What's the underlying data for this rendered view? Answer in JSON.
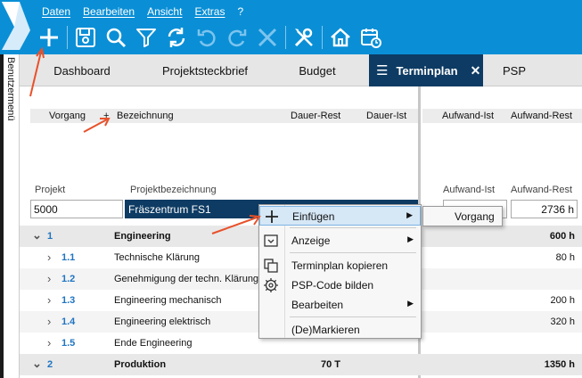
{
  "menu": [
    "Daten",
    "Bearbeiten",
    "Ansicht",
    "Extras",
    "?"
  ],
  "toolbar_icons": [
    "add-icon",
    "save-icon",
    "search-icon",
    "filter-icon",
    "refresh-icon",
    "undo-icon",
    "redo-icon",
    "delete-icon",
    "tools-icon",
    "home-icon",
    "calendar-icon"
  ],
  "sidebar": {
    "label": "Benutzermenü"
  },
  "tabs": [
    "Dashboard",
    "Projektsteckbrief",
    "Budget",
    "Terminplan",
    "PSP"
  ],
  "header": {
    "vorgang": "Vorgang",
    "plus": "+",
    "bezeichnung": "Bezeichnung",
    "dauer_rest": "Dauer-Rest",
    "dauer_ist": "Dauer-Ist",
    "aufwand_ist": "Aufwand-Ist",
    "aufwand_rest": "Aufwand-Rest"
  },
  "project_header": {
    "projekt": "Projekt",
    "projektbezeichnung": "Projektbezeichnung",
    "aufwand_ist": "Aufwand-Ist",
    "aufwand_rest": "Aufwand-Rest"
  },
  "project": {
    "nr": "5000",
    "name": "Fräszentrum FS1",
    "aufwand_rest": "2736 h"
  },
  "rows": [
    {
      "chev": "⌄",
      "code": "1",
      "name": "Engineering",
      "dauer": "",
      "aufwand": "600 h",
      "group": true
    },
    {
      "chev": "›",
      "code": "1.1",
      "name": "Technische Klärung",
      "dauer": "",
      "aufwand": "80 h",
      "group": false
    },
    {
      "chev": "›",
      "code": "1.2",
      "name": "Genehmigung der techn. Klärung",
      "dauer": "",
      "aufwand": "",
      "group": false
    },
    {
      "chev": "›",
      "code": "1.3",
      "name": "Engineering mechanisch",
      "dauer": "",
      "aufwand": "200 h",
      "group": false
    },
    {
      "chev": "›",
      "code": "1.4",
      "name": "Engineering elektrisch",
      "dauer": "",
      "aufwand": "320 h",
      "group": false
    },
    {
      "chev": "›",
      "code": "1.5",
      "name": "Ende Engineering",
      "dauer": "",
      "aufwand": "",
      "group": false
    },
    {
      "chev": "⌄",
      "code": "2",
      "name": "Produktion",
      "dauer": "70 T",
      "aufwand": "1350 h",
      "group": true
    }
  ],
  "context_menu": {
    "einfuegen": "Einfügen",
    "anzeige": "Anzeige",
    "terminplan_kopieren": "Terminplan kopieren",
    "psp_code": "PSP-Code bilden",
    "bearbeiten": "Bearbeiten",
    "markieren": "(De)Markieren"
  },
  "submenu": {
    "vorgang": "Vorgang"
  },
  "colors": {
    "top_bar": "#0a8fd6",
    "active_tab": "#0d3b63",
    "annotation_arrow": "#e8512b",
    "code_blue": "#1f74c2"
  }
}
